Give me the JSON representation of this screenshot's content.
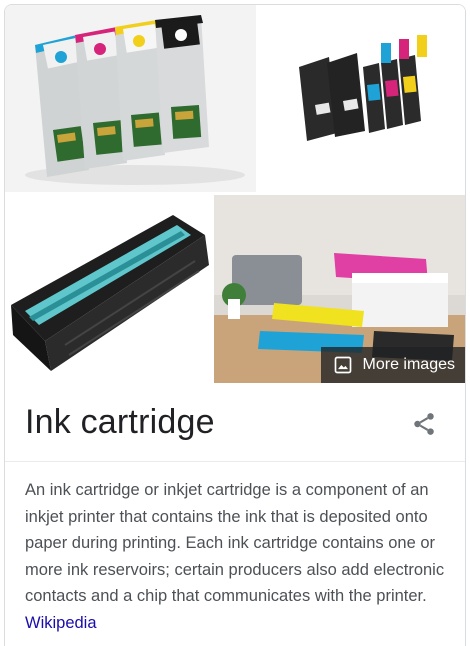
{
  "gallery": {
    "images": [
      {
        "alt_icon": "ink-cartridges-four-color-image"
      },
      {
        "alt_icon": "ink-cartridges-set-image"
      },
      {
        "alt_icon": "toner-cartridge-image"
      },
      {
        "alt_icon": "toner-cartridges-desk-image"
      }
    ],
    "more_images_label": "More images",
    "more_images_icon": "image-icon"
  },
  "entity": {
    "title": "Ink cartridge",
    "share_icon": "share-icon",
    "description": "An ink cartridge or inkjet cartridge is a component of an inkjet printer that contains the ink that is deposited onto paper during printing. Each ink cartridge contains one or more ink reservoirs; certain producers also add electronic contacts and a chip that communicates with the printer.",
    "source_link": "Wikipedia"
  },
  "colors": {
    "cyan": "#1fa3d6",
    "magenta": "#d6247a",
    "yellow": "#f2cf1a",
    "black": "#1b1b1b",
    "link": "#1a0dab",
    "text": "#4d5156",
    "title": "#202124"
  }
}
